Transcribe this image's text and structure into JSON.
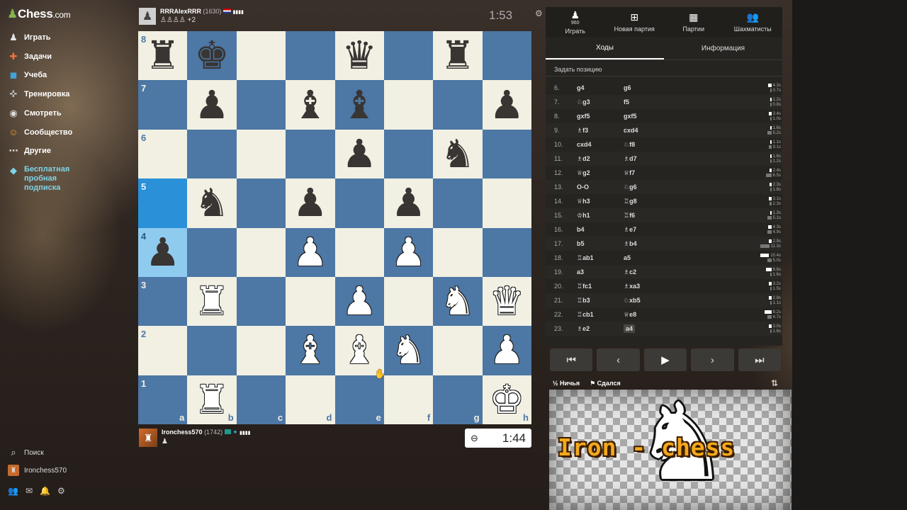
{
  "site": {
    "logo_main": "Chess",
    "logo_dom": ".com"
  },
  "nav": {
    "items": [
      {
        "label": "Играть",
        "icon": "play-icon"
      },
      {
        "label": "Задачи",
        "icon": "puzzle-icon"
      },
      {
        "label": "Учеба",
        "icon": "learn-icon"
      },
      {
        "label": "Тренировка",
        "icon": "practice-icon"
      },
      {
        "label": "Смотреть",
        "icon": "watch-icon"
      },
      {
        "label": "Сообщество",
        "icon": "community-icon"
      },
      {
        "label": "Другие",
        "icon": "more-icon"
      }
    ],
    "promo": "Бесплатная пробная подписка",
    "search": "Поиск",
    "user": "Ironchess570"
  },
  "top_player": {
    "name": "RRRAlexRRR",
    "rating": "(1630)",
    "captured": "♙♙♙♙ +2",
    "clock": "1:53"
  },
  "bottom_player": {
    "name": "Ironchess570",
    "rating": "(1742)",
    "captured": "♟",
    "clock": "1:44"
  },
  "board": {
    "ranks": [
      "8",
      "7",
      "6",
      "5",
      "4",
      "3",
      "2",
      "1"
    ],
    "files": [
      "a",
      "b",
      "c",
      "d",
      "e",
      "f",
      "g",
      "h"
    ],
    "position": [
      [
        "r",
        "k",
        "",
        "",
        "q",
        "",
        "r",
        ""
      ],
      [
        "",
        "p",
        "",
        "b",
        "b",
        "",
        "",
        "p"
      ],
      [
        "",
        "",
        "",
        "",
        "p",
        "",
        "n",
        ""
      ],
      [
        "",
        "n",
        "",
        "p",
        "",
        "p",
        "",
        ""
      ],
      [
        "p",
        "",
        "",
        "P",
        "",
        "P",
        "",
        ""
      ],
      [
        "",
        "R",
        "",
        "",
        "P",
        "",
        "N",
        "Q"
      ],
      [
        "",
        "",
        "",
        "B",
        "B",
        "N",
        "",
        "P"
      ],
      [
        "",
        "R",
        "",
        "",
        "",
        "",
        "",
        "K"
      ]
    ],
    "highlights": [
      "a5",
      "a4"
    ]
  },
  "panel": {
    "top_tabs": [
      {
        "label": "Играть",
        "icon": "play-icon",
        "badge": "960"
      },
      {
        "label": "Новая партия",
        "icon": "plus-icon"
      },
      {
        "label": "Партии",
        "icon": "games-icon"
      },
      {
        "label": "Шахматисты",
        "icon": "players-icon"
      }
    ],
    "sub_tabs": [
      "Ходы",
      "Информация"
    ],
    "set_position": "Задать позицию",
    "moves": [
      {
        "n": "6.",
        "w": "g4",
        "b": "g6",
        "tw": "4.3s",
        "tb": "0.7s"
      },
      {
        "n": "7.",
        "w": "♘g3",
        "b": "f5",
        "tw": "1.2s",
        "tb": "0.8s"
      },
      {
        "n": "8.",
        "w": "gxf5",
        "b": "gxf5",
        "tw": "3.4s",
        "tb": "1.0s"
      },
      {
        "n": "9.",
        "w": "♗f3",
        "b": "cxd4",
        "tw": "1.6s",
        "tb": "5.2s"
      },
      {
        "n": "10.",
        "w": "cxd4",
        "b": "♘f8",
        "tw": "1.1s",
        "tb": "3.1s"
      },
      {
        "n": "11.",
        "w": "♗d2",
        "b": "♗d7",
        "tw": "1.6s",
        "tb": "1.2s"
      },
      {
        "n": "12.",
        "w": "♕g2",
        "b": "♕f7",
        "tw": "2.4s",
        "tb": "6.5s"
      },
      {
        "n": "13.",
        "w": "O-O",
        "b": "♘g6",
        "tw": "2.3s",
        "tb": "1.8s"
      },
      {
        "n": "14.",
        "w": "♕h3",
        "b": "♖g8",
        "tw": "3.1s",
        "tb": "2.3s"
      },
      {
        "n": "15.",
        "w": "♔h1",
        "b": "♖f6",
        "tw": "1.3s",
        "tb": "5.1s"
      },
      {
        "n": "16.",
        "w": "b4",
        "b": "♗e7",
        "tw": "4.3s",
        "tb": "4.9s"
      },
      {
        "n": "17.",
        "w": "b5",
        "b": "♗b4",
        "tw": "2.9s",
        "tb": "11.3s"
      },
      {
        "n": "18.",
        "w": "♖ab1",
        "b": "a5",
        "tw": "10.4s",
        "tb": "5.0s"
      },
      {
        "n": "19.",
        "w": "a3",
        "b": "♗c2",
        "tw": "6.6s",
        "tb": "1.6s"
      },
      {
        "n": "20.",
        "w": "♖fc1",
        "b": "♗xa3",
        "tw": "3.2s",
        "tb": "1.5s"
      },
      {
        "n": "21.",
        "w": "♖b3",
        "b": "♘xb5",
        "tw": "2.8s",
        "tb": "1.1s"
      },
      {
        "n": "22.",
        "w": "♖cb1",
        "b": "♕e8",
        "tw": "8.2s",
        "tb": "4.7s"
      },
      {
        "n": "23.",
        "w": "♗e2",
        "b": "a4",
        "tw": "3.0s",
        "tb": "1.6s"
      }
    ],
    "draw": "Ничья",
    "resign": "Сдался"
  },
  "overlay": {
    "brand": "Iron - chess"
  }
}
